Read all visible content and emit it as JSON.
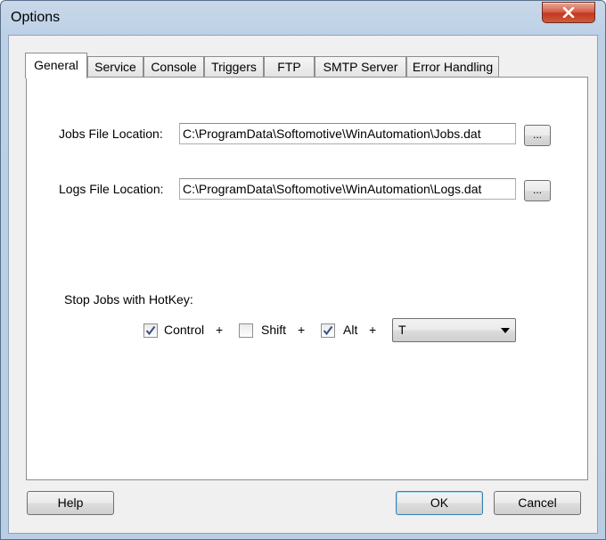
{
  "window": {
    "title": "Options"
  },
  "tabs": [
    {
      "label": "General",
      "active": true
    },
    {
      "label": "Service",
      "active": false
    },
    {
      "label": "Console",
      "active": false
    },
    {
      "label": "Triggers",
      "active": false
    },
    {
      "label": "FTP",
      "active": false
    },
    {
      "label": "SMTP Server",
      "active": false
    },
    {
      "label": "Error Handling",
      "active": false
    }
  ],
  "general": {
    "jobs_file": {
      "label": "Jobs File Location:",
      "value": "C:\\ProgramData\\Softomotive\\WinAutomation\\Jobs.dat",
      "browse_label": "..."
    },
    "logs_file": {
      "label": "Logs File Location:",
      "value": "C:\\ProgramData\\Softomotive\\WinAutomation\\Logs.dat",
      "browse_label": "..."
    },
    "hotkey": {
      "label": "Stop Jobs with HotKey:",
      "control": {
        "label": "Control",
        "checked": true
      },
      "shift": {
        "label": "Shift",
        "checked": false
      },
      "alt": {
        "label": "Alt",
        "checked": true
      },
      "plus": "+",
      "key": "T"
    }
  },
  "buttons": {
    "help": "Help",
    "ok": "OK",
    "cancel": "Cancel"
  },
  "colors": {
    "title_gradient": "#bcd0e6",
    "close_red": "#c3391f",
    "panel_bg": "#ffffff",
    "dialog_bg": "#f0f0f0"
  }
}
